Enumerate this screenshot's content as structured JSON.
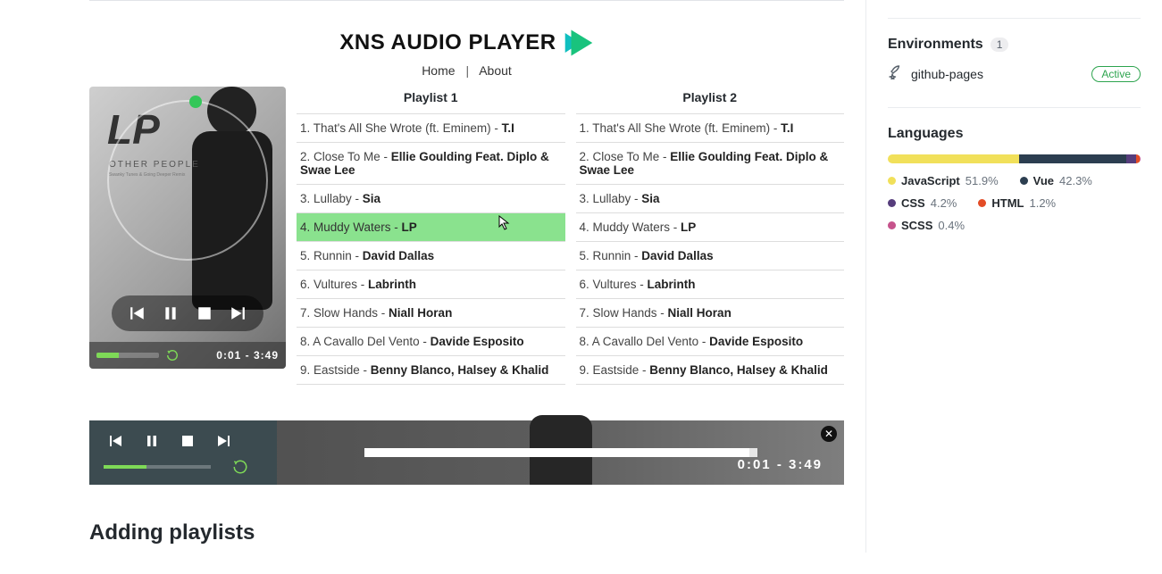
{
  "app": {
    "title": "XNS AUDIO PLAYER",
    "nav_home": "Home",
    "nav_about": "About"
  },
  "album": {
    "lp": "LP",
    "sub": "OTHER PEOPLE",
    "sub2": "Swanky Tunes & Going Deeper Remix",
    "time": "0:01 - 3:49"
  },
  "bottom_player": {
    "time": "0:01 - 3:49"
  },
  "playlist_titles": [
    "Playlist 1",
    "Playlist 2"
  ],
  "tracks": [
    {
      "n": "1",
      "title": "That's All She Wrote (ft. Eminem)",
      "artist": "T.I"
    },
    {
      "n": "2",
      "title": "Close To Me",
      "artist": "Ellie Goulding Feat. Diplo & Swae Lee"
    },
    {
      "n": "3",
      "title": "Lullaby",
      "artist": "Sia"
    },
    {
      "n": "4",
      "title": "Muddy Waters",
      "artist": "LP"
    },
    {
      "n": "5",
      "title": "Runnin",
      "artist": "David Dallas"
    },
    {
      "n": "6",
      "title": "Vultures",
      "artist": "Labrinth"
    },
    {
      "n": "7",
      "title": "Slow Hands",
      "artist": "Niall Horan"
    },
    {
      "n": "8",
      "title": "A Cavallo Del Vento",
      "artist": "Davide Esposito"
    },
    {
      "n": "9",
      "title": "Eastside",
      "artist": "Benny Blanco, Halsey & Khalid"
    }
  ],
  "selected_track_index_pl1": 3,
  "heading": "Adding playlists",
  "sidebar": {
    "env_title": "Environments",
    "env_count": "1",
    "env_name": "github-pages",
    "env_status": "Active",
    "lang_title": "Languages",
    "langs": [
      {
        "name": "JavaScript",
        "pct": "51.9%",
        "color": "#f1e05a",
        "w": 51.9
      },
      {
        "name": "Vue",
        "pct": "42.3%",
        "color": "#2c3e50",
        "w": 42.3
      },
      {
        "name": "CSS",
        "pct": "4.2%",
        "color": "#563d7c",
        "w": 4.2
      },
      {
        "name": "HTML",
        "pct": "1.2%",
        "color": "#e34c26",
        "w": 1.2
      },
      {
        "name": "SCSS",
        "pct": "0.4%",
        "color": "#c6538c",
        "w": 0.4
      }
    ]
  }
}
